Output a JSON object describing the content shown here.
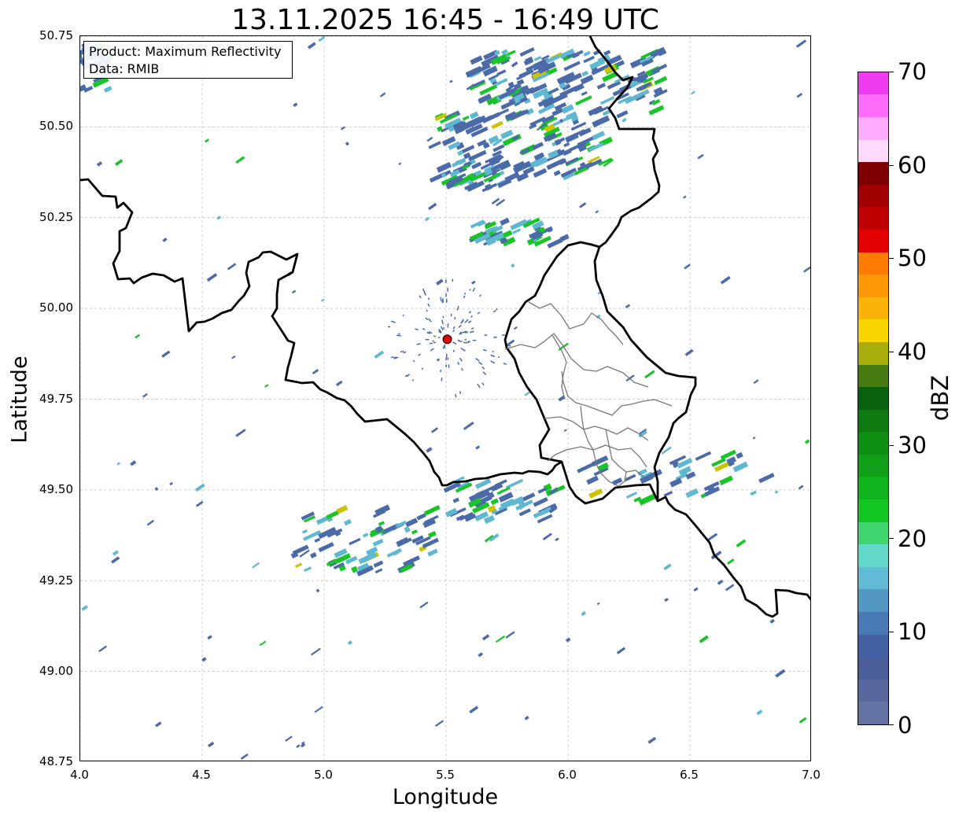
{
  "title": "13.11.2025 16:45 - 16:49 UTC",
  "info_box": {
    "line1": "Product: Maximum Reflectivity",
    "line2": "Data: RMIB"
  },
  "axes": {
    "xlabel": "Longitude",
    "ylabel": "Latitude",
    "xlim": [
      4.0,
      7.0
    ],
    "ylim": [
      48.75,
      50.75
    ],
    "xticks": [
      "4.0",
      "4.5",
      "5.0",
      "5.5",
      "6.0",
      "6.5",
      "7.0"
    ],
    "yticks": [
      "50.75",
      "50.50",
      "50.25",
      "50.00",
      "49.75",
      "49.50",
      "49.25",
      "49.00",
      "48.75"
    ],
    "grid": true
  },
  "radar_site": {
    "lon": 5.505,
    "lat": 49.915,
    "color": "#e00000"
  },
  "colorbar": {
    "label": "dBZ",
    "ticks": [
      "0",
      "10",
      "20",
      "30",
      "40",
      "50",
      "60",
      "70"
    ],
    "range": [
      0,
      70
    ],
    "step": 2.5,
    "colors": [
      "#6373a4",
      "#57689e",
      "#4b5d99",
      "#4261a2",
      "#4a7ab4",
      "#5398c3",
      "#61bad6",
      "#62d8c8",
      "#3fd56f",
      "#13c722",
      "#10b51d",
      "#109f17",
      "#0f8e14",
      "#0d7b10",
      "#08620b",
      "#457a10",
      "#a9ad0b",
      "#f9d602",
      "#fbb30a",
      "#fd9808",
      "#fe7c04",
      "#e30000",
      "#bf0000",
      "#a20000",
      "#7e0000",
      "#ffd9ff",
      "#ffacff",
      "#ff6dfa",
      "#ef3aef"
    ]
  },
  "map_features": {
    "national_borders": "Belgium / Luxembourg / France / Germany",
    "internal_borders": "Luxembourg cantons",
    "echo_colors": {
      "weak": "#4b6aa8",
      "moderate": "#5fb8d0",
      "strong": "#18c428",
      "heavy": "#c9c300"
    }
  }
}
